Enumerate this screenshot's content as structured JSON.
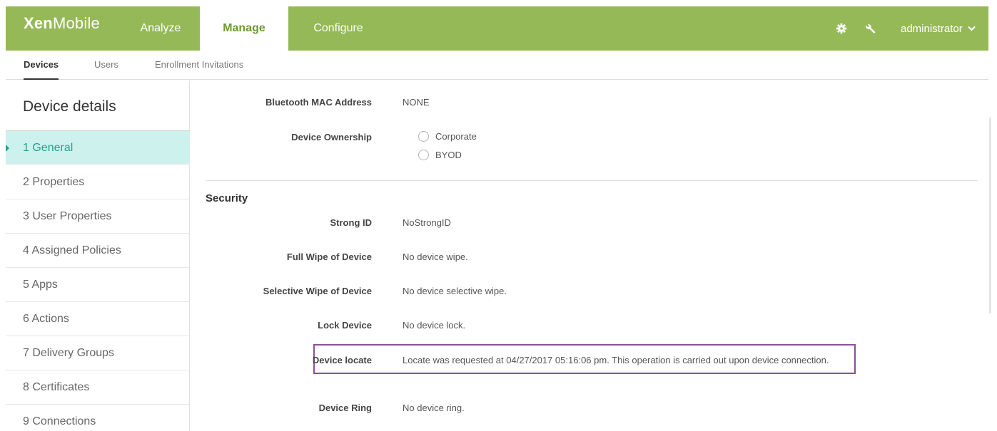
{
  "app": {
    "logo_bold": "Xen",
    "logo_light": "Mobile"
  },
  "nav": {
    "tabs": [
      {
        "label": "Analyze"
      },
      {
        "label": "Manage"
      },
      {
        "label": "Configure"
      }
    ],
    "user": "administrator"
  },
  "subnav": {
    "tabs": [
      {
        "label": "Devices"
      },
      {
        "label": "Users"
      },
      {
        "label": "Enrollment Invitations"
      }
    ]
  },
  "sidebar": {
    "title": "Device details",
    "steps": [
      {
        "label": "1 General"
      },
      {
        "label": "2 Properties"
      },
      {
        "label": "3 User Properties"
      },
      {
        "label": "4 Assigned Policies"
      },
      {
        "label": "5 Apps"
      },
      {
        "label": "6 Actions"
      },
      {
        "label": "7 Delivery Groups"
      },
      {
        "label": "8 Certificates"
      },
      {
        "label": "9 Connections"
      }
    ]
  },
  "details": {
    "bluetooth": {
      "label": "Bluetooth MAC Address",
      "value": "NONE"
    },
    "ownership": {
      "label": "Device Ownership",
      "options": [
        "Corporate",
        "BYOD"
      ]
    },
    "security_title": "Security",
    "strong_id": {
      "label": "Strong ID",
      "value": "NoStrongID"
    },
    "full_wipe": {
      "label": "Full Wipe of Device",
      "value": "No device wipe."
    },
    "selective_wipe": {
      "label": "Selective Wipe of Device",
      "value": "No device selective wipe."
    },
    "lock": {
      "label": "Lock Device",
      "value": "No device lock."
    },
    "locate": {
      "label": "Device locate",
      "value": "Locate was requested at 04/27/2017 05:16:06 pm. This operation is carried out upon device connection."
    },
    "ring": {
      "label": "Device Ring",
      "value": "No device ring."
    }
  },
  "icons": {
    "settings": "gear-icon",
    "tools": "wrench-icon",
    "user_menu": "chevron-down-icon"
  },
  "colors": {
    "brand_green": "#95b957",
    "active_step_bg": "#cdf1ec",
    "highlight": "#8d4e9e"
  }
}
